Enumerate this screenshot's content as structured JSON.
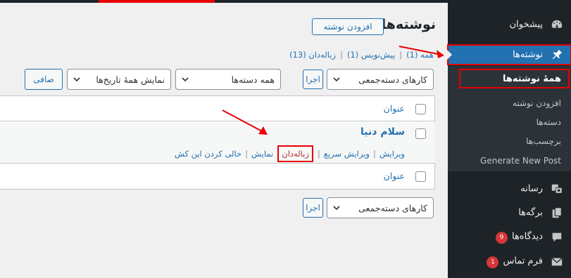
{
  "sidebar": {
    "dashboard": "پیشخوان",
    "posts": "نوشته‌ها",
    "sub_all": "همهٔ نوشته‌ها",
    "sub_add": "افزودن نوشته",
    "sub_categories": "دسته‌ها",
    "sub_tags": "برچسب‌ها",
    "sub_generate": "Generate New Post",
    "media": "رسانه",
    "pages": "برگه‌ها",
    "comments": "دیدگاه‌ها",
    "comments_badge": "9",
    "contact": "فرم تماس",
    "contact_badge": "1"
  },
  "header": {
    "title": "نوشته‌ها",
    "add_new": "افزودن نوشته"
  },
  "filters": {
    "all": "همه (1)",
    "drafts": "پیش‌نویس (1)",
    "trash": "زباله‌دان (13)",
    "sep": "|"
  },
  "toolbar": {
    "bulk_actions": "کارهای دسته‌جمعی",
    "apply": "اجرا",
    "categories": "همه دسته‌ها",
    "dates": "نمایش همهٔ تاریخ‌ها",
    "filter": "صافی"
  },
  "table": {
    "column_title": "عنوان",
    "post_title": "سلام دنیا",
    "actions": {
      "edit": "ویرایش",
      "quick_edit": "ویرایش سریع",
      "trash": "زباله‌دان",
      "view": "نمایش",
      "empty_cache": "خالی کردن این کش"
    }
  },
  "colors": {
    "sidebar_bg": "#1d2327",
    "active_bg": "#2271b1",
    "highlight": "#e60000",
    "link": "#2271b1"
  }
}
